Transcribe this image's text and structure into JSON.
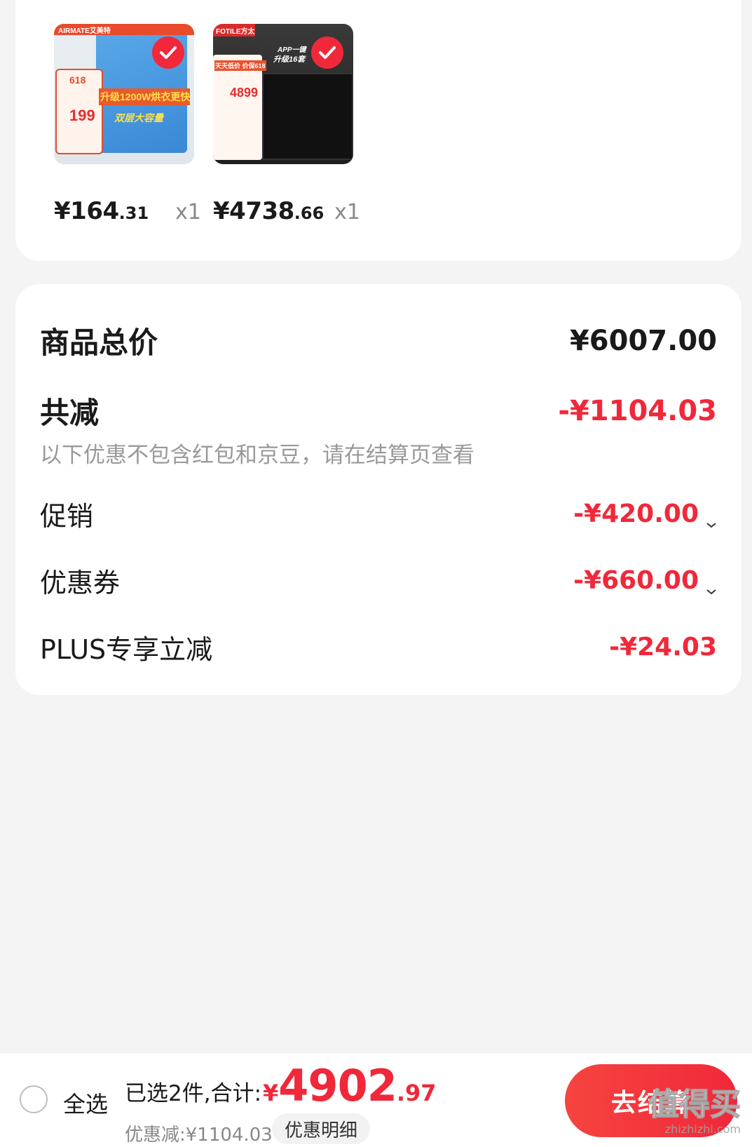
{
  "products": [
    {
      "price_main": "¥164",
      "price_dec": ".31",
      "qty": "x1",
      "brand": "AIRMATE艾美特",
      "promo_line1": "升级1200W烘衣更快",
      "promo_line2": "双层大容量",
      "promo_price": "199",
      "promo_badge": "618",
      "selected": true
    },
    {
      "price_main": "¥4738",
      "price_dec": ".66",
      "qty": "x1",
      "brand": "FOTILE方太",
      "promo_line1": "APP一键",
      "promo_line2": "升级16套",
      "promo_badge": "天天低价 价保618",
      "promo_price": "4899",
      "selected": true
    }
  ],
  "summary": {
    "total_label": "商品总价",
    "total_value": "¥6007.00",
    "reduce_label": "共减",
    "reduce_value": "-¥1104.03",
    "note": "以下优惠不包含红包和京豆，请在结算页查看",
    "items": [
      {
        "label": "促销",
        "value": "-¥420.00",
        "expandable": true
      },
      {
        "label": "优惠券",
        "value": "-¥660.00",
        "expandable": true
      },
      {
        "label": "PLUS专享立减",
        "value": "-¥24.03",
        "expandable": false
      }
    ]
  },
  "bottom_bar": {
    "select_all": "全选",
    "total_prefix": "已选2件,合计:",
    "total_yen": "¥",
    "total_int": "4902",
    "total_dec": ".97",
    "discount_text": "优惠减:¥1104.03",
    "detail_button": "优惠明细",
    "checkout_button": "去结算"
  },
  "watermark": {
    "text": "值得买",
    "sub": "zhizhizhi.com"
  },
  "colors": {
    "accent": "#f0283a",
    "background": "#f4f4f4"
  }
}
